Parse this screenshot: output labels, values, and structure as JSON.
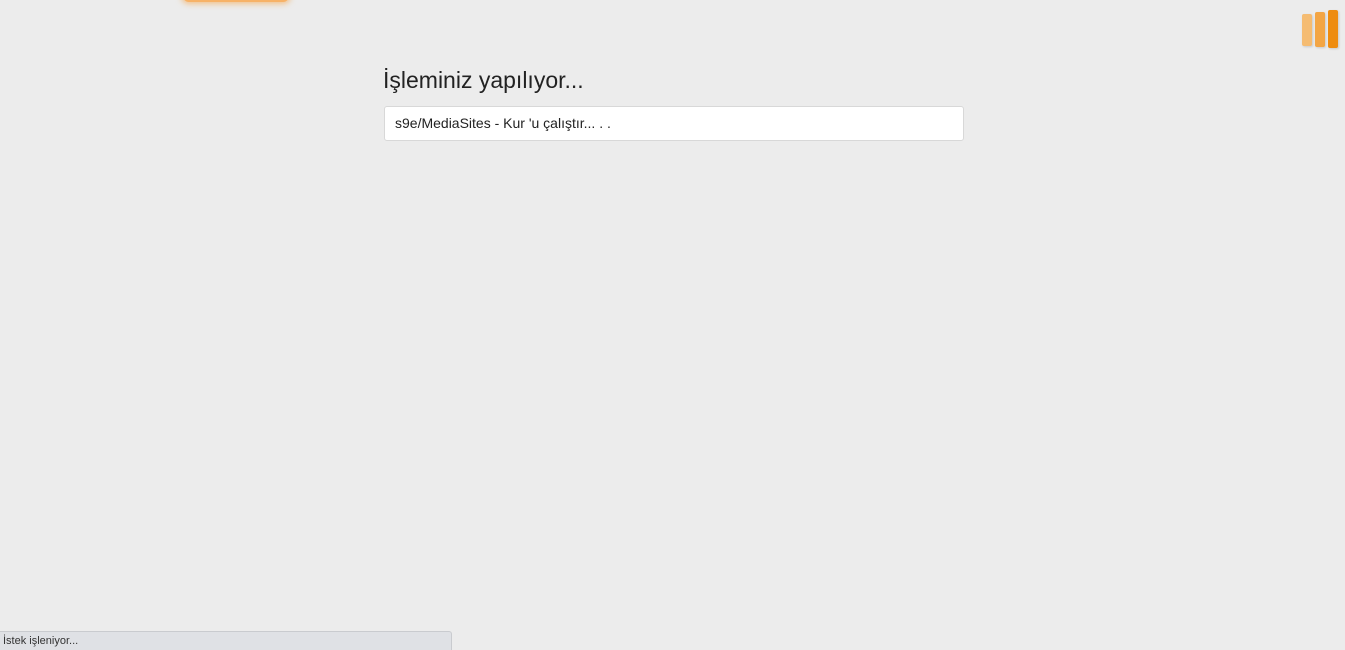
{
  "page": {
    "title": "İşleminiz yapılıyor...",
    "progress_text": "s9e/MediaSites - Kur 'u çalıştır... . ."
  },
  "loader": {
    "icon": "loading-bars-icon",
    "colors": [
      "#f5bc72",
      "#f3a544",
      "#ee8c10"
    ]
  },
  "status_bar": {
    "text": "İstek işleniyor..."
  },
  "colors": {
    "background": "#ececec",
    "accent": "#ee8c10"
  }
}
